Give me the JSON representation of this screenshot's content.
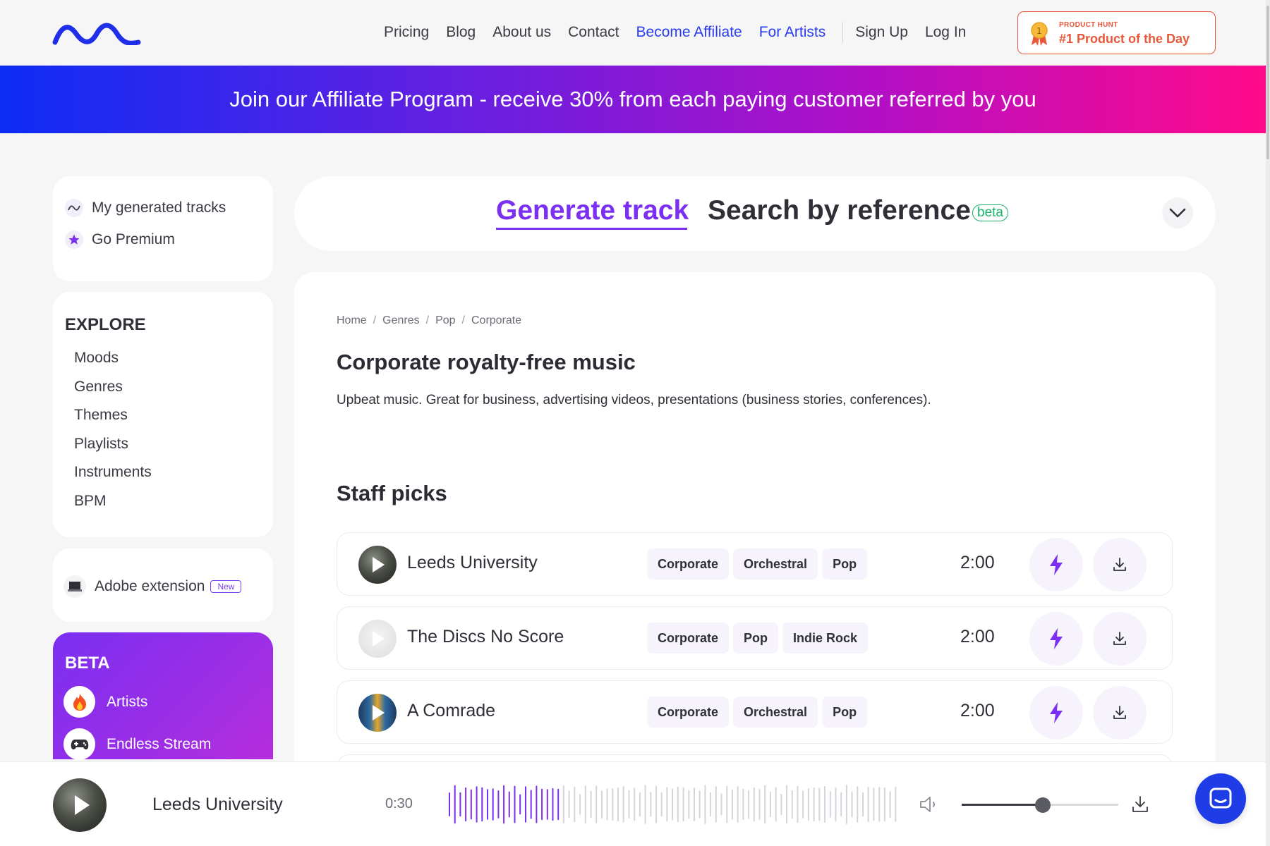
{
  "nav": {
    "links": [
      "Pricing",
      "Blog",
      "About us",
      "Contact"
    ],
    "affiliate": "Become Affiliate",
    "artists": "For Artists",
    "signup": "Sign Up",
    "login": "Log In",
    "badge_small": "PRODUCT HUNT",
    "badge_big": "#1 Product of the Day",
    "accent": "#2b3cf0"
  },
  "banner": {
    "text": "Join our Affiliate Program - receive 30% from each paying customer referred by you"
  },
  "sidebar": {
    "my_tracks": "My generated tracks",
    "premium": "Go Premium",
    "explore_title": "EXPLORE",
    "explore_items": [
      "Moods",
      "Genres",
      "Themes",
      "Playlists",
      "Instruments",
      "BPM"
    ],
    "adobe": "Adobe extension",
    "adobe_badge": "New",
    "beta_title": "BETA",
    "beta_items": [
      "Artists",
      "Endless Stream"
    ]
  },
  "tabs": {
    "generate": "Generate track",
    "reference": "Search by reference",
    "beta": "beta"
  },
  "main": {
    "breadcrumb": [
      "Home",
      "Genres",
      "Pop",
      "Corporate"
    ],
    "title": "Corporate royalty-free music",
    "description": "Upbeat music. Great for business, advertising videos, presentations (business stories, conferences).",
    "section": "Staff picks",
    "tracks": [
      {
        "name": "Leeds University",
        "tags": [
          "Corporate",
          "Orchestral",
          "Pop"
        ],
        "duration": "2:00"
      },
      {
        "name": "The Discs No Score",
        "tags": [
          "Corporate",
          "Pop",
          "Indie Rock"
        ],
        "duration": "2:00"
      },
      {
        "name": "A Comrade",
        "tags": [
          "Corporate",
          "Orchestral",
          "Pop"
        ],
        "duration": "2:00"
      }
    ]
  },
  "player": {
    "title": "Leeds University",
    "time": "0:30",
    "progress": 0.25,
    "volume": 0.52,
    "accent": "#7b2ff0"
  }
}
